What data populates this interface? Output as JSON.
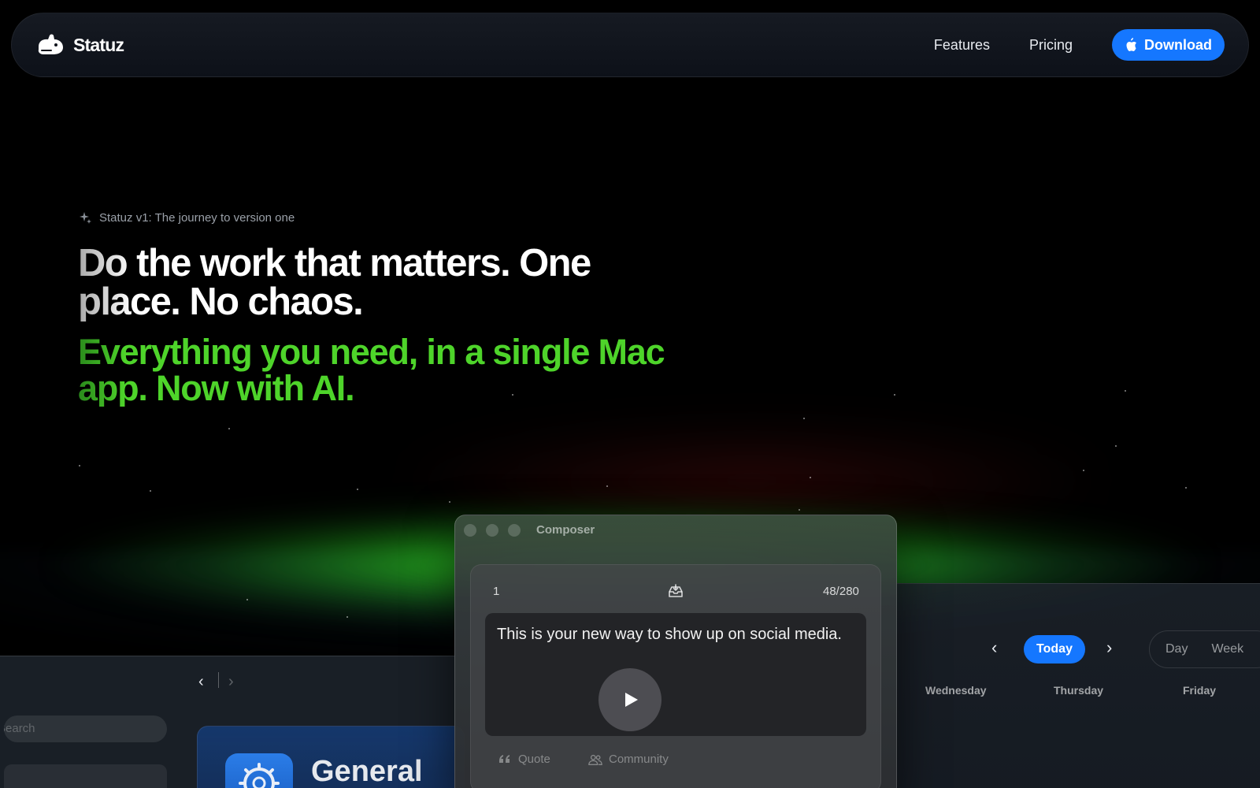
{
  "nav": {
    "brand": "Statuz",
    "links": [
      {
        "label": "Features"
      },
      {
        "label": "Pricing"
      }
    ],
    "download_label": "Download",
    "accent_color": "#1577ff"
  },
  "hero": {
    "eyebrow": "Statuz v1: The journey to version one",
    "headline": "Do the work that matters. One place. No chaos.",
    "subline": "Everything you need, in a single Mac app. Now with AI.",
    "subline_color": "#4ed42a"
  },
  "settings_window": {
    "search_placeholder": "Search",
    "card_title": "General"
  },
  "calendar_window": {
    "today_label": "Today",
    "view_options": [
      "Day",
      "Week"
    ],
    "day_headers": [
      "Wednesday",
      "Thursday",
      "Friday"
    ]
  },
  "composer": {
    "title": "Composer",
    "post_index": "1",
    "char_count": "48/280",
    "post_text": "This is your new way to show up on social media.",
    "actions": [
      {
        "label": "Quote",
        "icon": "quote-icon"
      },
      {
        "label": "Community",
        "icon": "community-icon"
      }
    ]
  }
}
